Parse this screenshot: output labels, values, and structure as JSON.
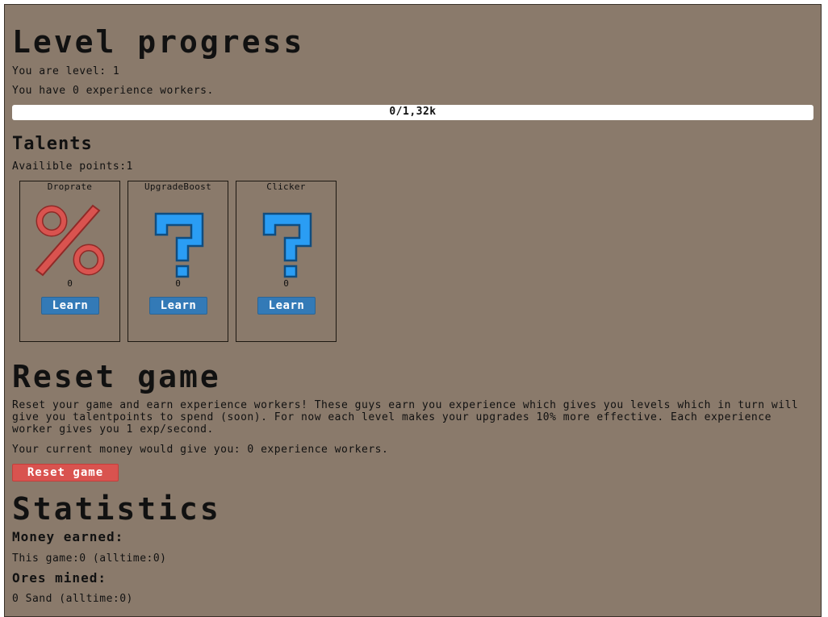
{
  "level_progress": {
    "title": "Level progress",
    "level_text": "You are level: 1",
    "workers_text": "You have 0 experience workers.",
    "xp_text": "0/1,32k",
    "xp_fraction": 0
  },
  "talents": {
    "title": "Talents",
    "points_text": "Availible points:1",
    "items": [
      {
        "name": "Droprate",
        "icon": "percent-icon",
        "count": "0",
        "button": "Learn"
      },
      {
        "name": "UpgradeBoost",
        "icon": "question-mark-icon",
        "count": "0",
        "button": "Learn"
      },
      {
        "name": "Clicker",
        "icon": "question-mark-icon",
        "count": "0",
        "button": "Learn"
      }
    ]
  },
  "reset": {
    "title": "Reset game",
    "description": "Reset your game and earn experience workers! These guys earn you experience which gives you levels which in turn will give you talentpoints to spend (soon). For now each level makes your upgrades 10% more effective. Each experience worker gives you 1 exp/second.",
    "current_text": "Your current money would give you: 0 experience workers.",
    "button": "Reset game"
  },
  "statistics": {
    "title": "Statistics",
    "money_heading": "Money earned:",
    "money_text": "This game:0 (alltime:0)",
    "ores_heading": "Ores mined:",
    "ores_text": "0 Sand (alltime:0)"
  },
  "colors": {
    "background": "#8a7a6b",
    "learn_button": "#337ab7",
    "reset_button": "#d9534f",
    "percent_icon": "#d9534f",
    "question_icon": "#2a9df4"
  }
}
